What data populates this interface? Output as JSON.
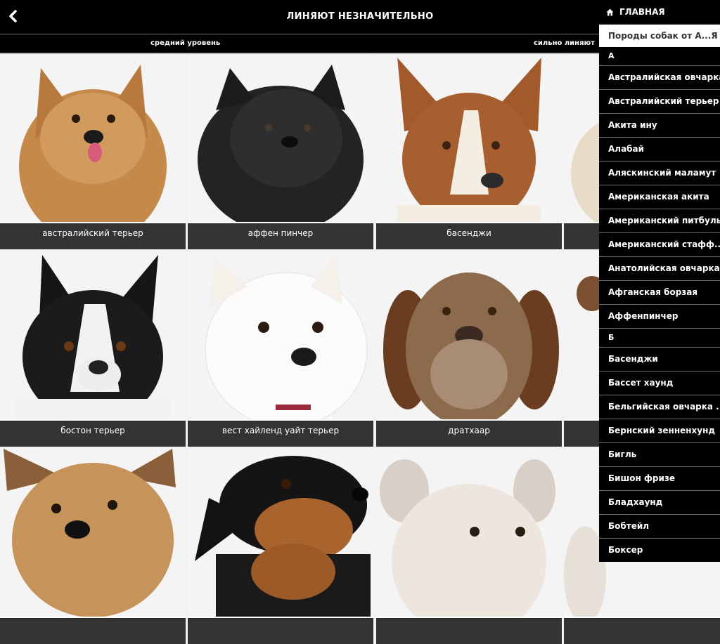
{
  "header": {
    "title": "ЛИНЯЮТ НЕЗНАЧИТЕЛЬНО",
    "back_icon": "chevron-left-icon"
  },
  "filters": {
    "medium": "средний уровень",
    "heavy": "сильно линяют"
  },
  "breeds": [
    {
      "name": "австралийский терьер"
    },
    {
      "name": "аффен пинчер"
    },
    {
      "name": "басенджи"
    },
    {
      "name": ""
    },
    {
      "name": "бостон терьер"
    },
    {
      "name": "вест хайленд уайт терьер"
    },
    {
      "name": "дратхаар"
    },
    {
      "name": ""
    },
    {
      "name": ""
    },
    {
      "name": ""
    },
    {
      "name": ""
    },
    {
      "name": ""
    }
  ],
  "menu": {
    "home_label": "ГЛАВНАЯ",
    "home_icon": "home-icon",
    "search_placeholder": "Породы собак от А...Я",
    "letter_a": "А",
    "items_a": [
      "Австралийская овчарка",
      "Австралийский терьер",
      "Акита ину",
      "Алабай",
      "Аляскинский маламут",
      "Американская акита",
      "Американский питбуль",
      "Американский стафф...",
      "Анатолийская овчарка",
      "Афганская борзая",
      "Аффенпинчер"
    ],
    "letter_b": "Б",
    "items_b": [
      "Басенджи",
      "Бассет хаунд",
      "Бельгийская овчарка ...",
      "Бернский зенненхунд",
      "Бигль",
      "Бишон фризе",
      "Бладхаунд",
      "Бобтейл",
      "Боксер"
    ]
  },
  "colors": {
    "bar": "#000000",
    "label_bg": "#333333",
    "divider": "#6b6b6b"
  }
}
